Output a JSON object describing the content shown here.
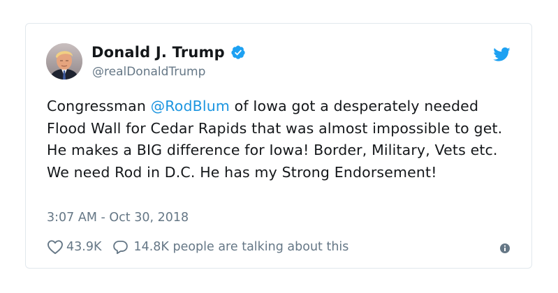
{
  "tweet": {
    "display_name": "Donald J. Trump",
    "handle": "@realDonaldTrump",
    "text_before_mention": "Congressman ",
    "mention": "@RodBlum",
    "text_after_mention": " of Iowa got a desperately needed Flood Wall for Cedar Rapids that was almost impossible to get. He makes a BIG difference for Iowa! Border, Military, Vets etc. We need Rod in D.C. He has my Strong Endorsement!",
    "timestamp": "3:07 AM - Oct 30, 2018",
    "like_count": "43.9K",
    "conversation_text": "14.8K people are talking about this"
  },
  "icons": {
    "verified": "verified-badge-icon",
    "brand": "twitter-bird-icon",
    "like": "heart-icon",
    "reply": "speech-bubble-icon",
    "info": "info-icon"
  },
  "colors": {
    "accent": "#1da1f2",
    "mention": "#1b95e0",
    "secondary_text": "#657786",
    "border": "#e1e8ed"
  }
}
